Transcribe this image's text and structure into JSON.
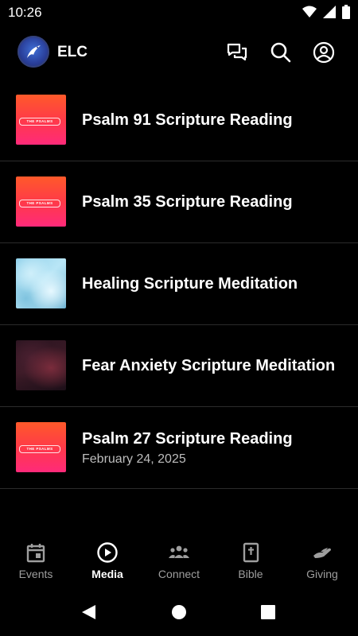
{
  "status_bar": {
    "time": "10:26",
    "icons": [
      "wifi-icon",
      "signal-icon",
      "battery-icon"
    ]
  },
  "header": {
    "title": "ELC",
    "actions": [
      "chat-icon",
      "search-icon",
      "account-icon"
    ]
  },
  "media_list": [
    {
      "title": "Psalm 91 Scripture Reading",
      "thumbnail": "the-psalms",
      "thumb_text": "THE PSALMS"
    },
    {
      "title": "Psalm 35 Scripture Reading",
      "thumbnail": "the-psalms",
      "thumb_text": "THE PSALMS"
    },
    {
      "title": "Healing Scripture Meditation",
      "thumbnail": "ice"
    },
    {
      "title": "Fear Anxiety Scripture Meditation",
      "thumbnail": "nebula"
    },
    {
      "title": "Psalm 27 Scripture Reading",
      "subtitle": "February 24, 2025",
      "thumbnail": "the-psalms",
      "thumb_text": "THE PSALMS"
    }
  ],
  "bottom_nav": {
    "items": [
      {
        "label": "Events",
        "icon": "calendar-icon"
      },
      {
        "label": "Media",
        "icon": "play-circle-icon",
        "active": true
      },
      {
        "label": "Connect",
        "icon": "group-icon"
      },
      {
        "label": "Bible",
        "icon": "bible-icon"
      },
      {
        "label": "Giving",
        "icon": "giving-hand-icon"
      }
    ]
  },
  "colors": {
    "background": "#000000",
    "text": "#ffffff",
    "inactive": "#9e9e9e",
    "divider": "#2b2b2b",
    "accent": "#ff3a48"
  }
}
